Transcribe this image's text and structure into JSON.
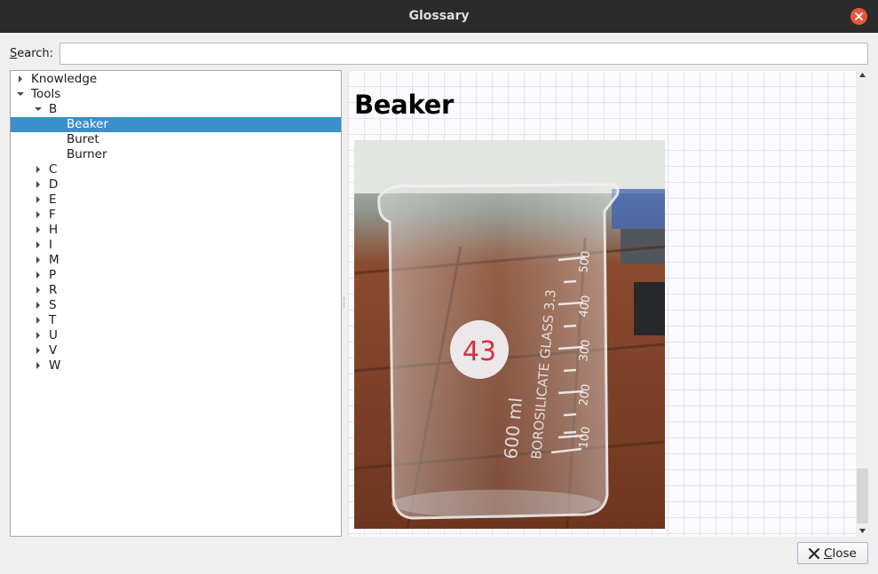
{
  "window": {
    "title": "Glossary",
    "close_icon": "window-close-icon",
    "close_color": "#e8573c"
  },
  "search": {
    "label_accel": "S",
    "label_rest": "earch:",
    "value": "",
    "placeholder": ""
  },
  "tree": {
    "selection_color": "#3a8fcc",
    "rows": [
      {
        "label": "Knowledge",
        "depth": 0,
        "expander": "collapsed"
      },
      {
        "label": "Tools",
        "depth": 0,
        "expander": "expanded"
      },
      {
        "label": "B",
        "depth": 1,
        "expander": "expanded"
      },
      {
        "label": "Beaker",
        "depth": 2,
        "expander": "none",
        "selected": true
      },
      {
        "label": "Buret",
        "depth": 2,
        "expander": "none"
      },
      {
        "label": "Burner",
        "depth": 2,
        "expander": "none"
      },
      {
        "label": "C",
        "depth": 1,
        "expander": "collapsed"
      },
      {
        "label": "D",
        "depth": 1,
        "expander": "collapsed"
      },
      {
        "label": "E",
        "depth": 1,
        "expander": "collapsed"
      },
      {
        "label": "F",
        "depth": 1,
        "expander": "collapsed"
      },
      {
        "label": "H",
        "depth": 1,
        "expander": "collapsed"
      },
      {
        "label": "I",
        "depth": 1,
        "expander": "collapsed"
      },
      {
        "label": "M",
        "depth": 1,
        "expander": "collapsed"
      },
      {
        "label": "P",
        "depth": 1,
        "expander": "collapsed"
      },
      {
        "label": "R",
        "depth": 1,
        "expander": "collapsed"
      },
      {
        "label": "S",
        "depth": 1,
        "expander": "collapsed"
      },
      {
        "label": "T",
        "depth": 1,
        "expander": "collapsed"
      },
      {
        "label": "U",
        "depth": 1,
        "expander": "collapsed"
      },
      {
        "label": "V",
        "depth": 1,
        "expander": "collapsed"
      },
      {
        "label": "W",
        "depth": 1,
        "expander": "collapsed"
      }
    ]
  },
  "viewer": {
    "heading": "Beaker",
    "image": {
      "subject": "beaker-photo",
      "label_number": "43",
      "glass_text": "BOROSILICATE GLASS 3.3",
      "volume_text": "600 ml",
      "graduations": [
        "500",
        "400",
        "300",
        "200",
        "100"
      ]
    }
  },
  "footer": {
    "close_accel": "C",
    "close_rest": "lose",
    "close_icon": "close-x-icon"
  }
}
